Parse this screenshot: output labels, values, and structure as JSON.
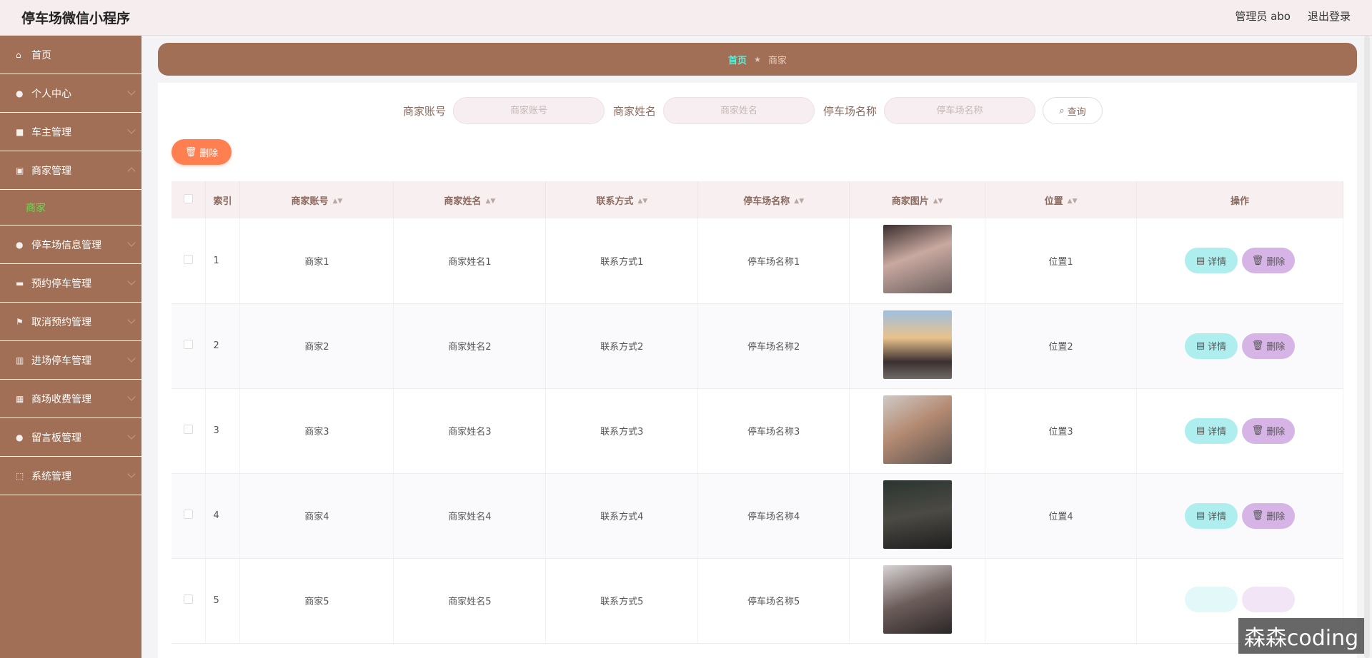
{
  "header": {
    "title": "停车场微信小程序",
    "admin_label": "管理员 abo",
    "logout_label": "退出登录"
  },
  "sidebar": {
    "items": [
      {
        "label": "首页",
        "icon": "home-icon"
      },
      {
        "label": "个人中心",
        "icon": "user-icon"
      },
      {
        "label": "车主管理",
        "icon": "car-icon"
      },
      {
        "label": "商家管理",
        "icon": "shop-icon"
      },
      {
        "label": "停车场信息管理",
        "icon": "user-icon"
      },
      {
        "label": "预约停车管理",
        "icon": "video-icon"
      },
      {
        "label": "取消预约管理",
        "icon": "flag-icon"
      },
      {
        "label": "进场停车管理",
        "icon": "building-icon"
      },
      {
        "label": "商场收费管理",
        "icon": "grid-icon"
      },
      {
        "label": "留言板管理",
        "icon": "user-icon"
      },
      {
        "label": "系统管理",
        "icon": "frame-icon"
      }
    ],
    "active_sub": "商家"
  },
  "breadcrumb": {
    "home": "首页",
    "separator": "★",
    "current": "商家"
  },
  "search": {
    "account_label": "商家账号",
    "account_placeholder": "商家账号",
    "name_label": "商家姓名",
    "name_placeholder": "商家姓名",
    "lot_label": "停车场名称",
    "lot_placeholder": "停车场名称",
    "query_label": "查询"
  },
  "actions": {
    "delete_label": "删除"
  },
  "table": {
    "headers": {
      "index": "索引",
      "account": "商家账号",
      "name": "商家姓名",
      "contact": "联系方式",
      "lot": "停车场名称",
      "image": "商家图片",
      "location": "位置",
      "ops": "操作"
    },
    "detail_label": "详情",
    "delete_label": "删除",
    "rows": [
      {
        "index": "1",
        "account": "商家1",
        "name": "商家姓名1",
        "contact": "联系方式1",
        "lot": "停车场名称1",
        "location": "位置1"
      },
      {
        "index": "2",
        "account": "商家2",
        "name": "商家姓名2",
        "contact": "联系方式2",
        "lot": "停车场名称2",
        "location": "位置2"
      },
      {
        "index": "3",
        "account": "商家3",
        "name": "商家姓名3",
        "contact": "联系方式3",
        "lot": "停车场名称3",
        "location": "位置3"
      },
      {
        "index": "4",
        "account": "商家4",
        "name": "商家姓名4",
        "contact": "联系方式4",
        "lot": "停车场名称4",
        "location": "位置4"
      },
      {
        "index": "5",
        "account": "商家5",
        "name": "商家姓名5",
        "contact": "联系方式5",
        "lot": "停车场名称5",
        "location": ""
      }
    ]
  },
  "watermark": "森森coding",
  "colors": {
    "sidebar": "#a06f55",
    "active_sub": "#63e04a",
    "crumb_home": "#5cf0d9",
    "delete_button": "#ff7f50",
    "detail_button": "#aeeeee",
    "row_delete_button": "#d6b4e6"
  }
}
